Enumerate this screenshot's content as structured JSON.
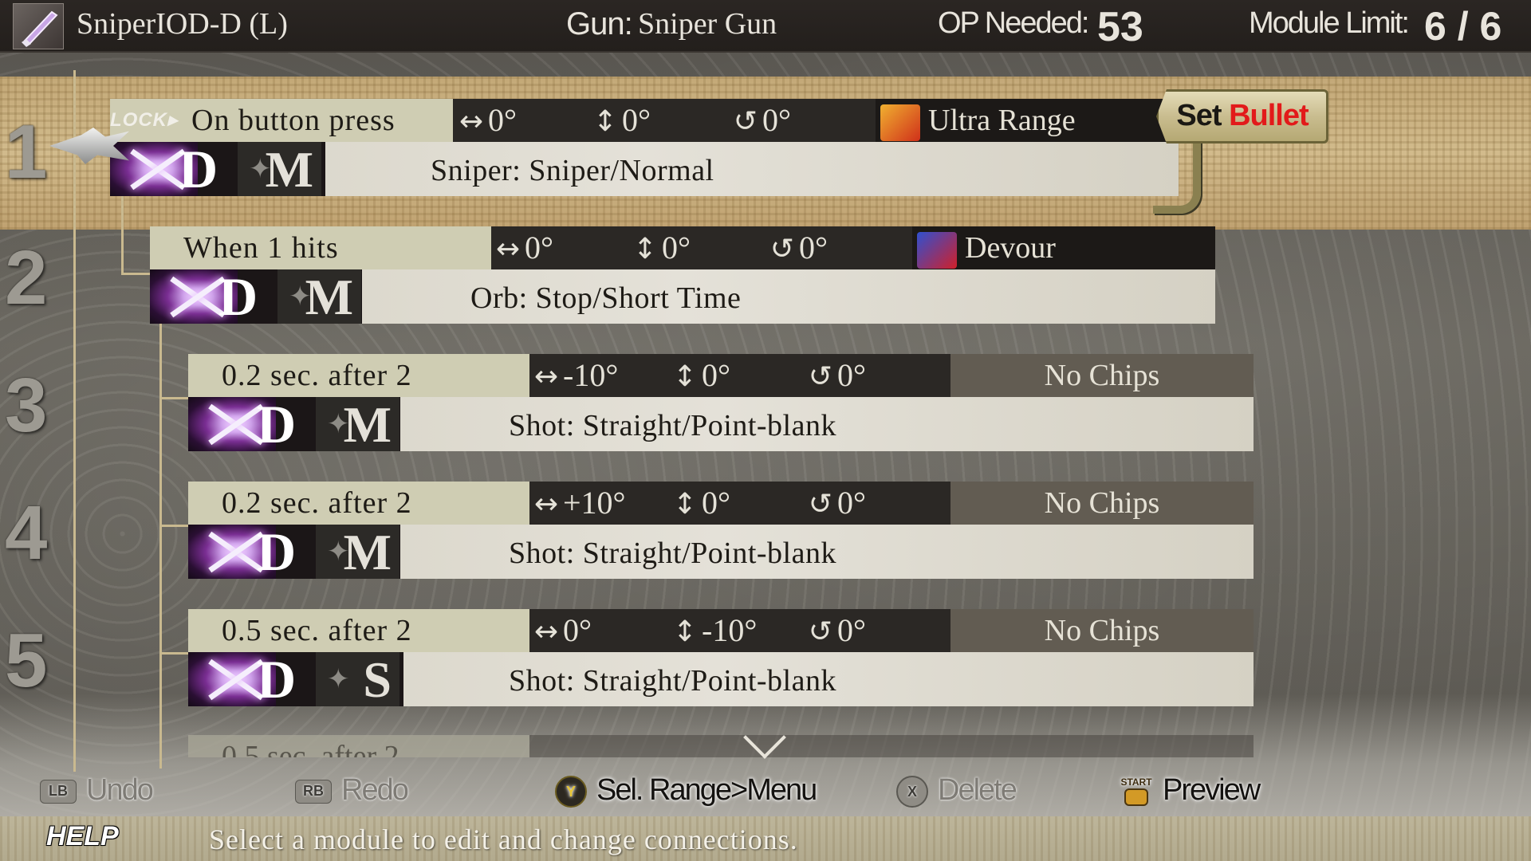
{
  "header": {
    "bullet_name": "SniperIOD-D (L)",
    "gun_label": "Gun:",
    "gun_value": "Sniper Gun",
    "op_label": "OP Needed:",
    "op_value": "53",
    "module_label": "Module  Limit:",
    "module_value": "6 / 6"
  },
  "lock_label": "LOCK▸",
  "set_bullet": {
    "part1": "Set ",
    "part2": "Bullet"
  },
  "rows": [
    {
      "number": "1",
      "trigger": "On button press",
      "h_angle": "0°",
      "v_angle": "0°",
      "r_angle": "0°",
      "chip": "Ultra Range",
      "badge_letter": "D",
      "size": "M",
      "bullet": "Sniper: Sniper/Normal"
    },
    {
      "number": "2",
      "trigger": "When  1  hits",
      "h_angle": "0°",
      "v_angle": "0°",
      "r_angle": "0°",
      "chip": "Devour",
      "badge_letter": "D",
      "size": "M",
      "bullet": "Orb: Stop/Short Time"
    },
    {
      "number": "3",
      "trigger": "0.2  sec.  after  2",
      "h_angle": "-10°",
      "v_angle": "0°",
      "r_angle": "0°",
      "chip": "No Chips",
      "badge_letter": "D",
      "size": "M",
      "bullet": "Shot: Straight/Point-blank"
    },
    {
      "number": "4",
      "trigger": "0.2  sec.  after  2",
      "h_angle": "+10°",
      "v_angle": "0°",
      "r_angle": "0°",
      "chip": "No Chips",
      "badge_letter": "D",
      "size": "M",
      "bullet": "Shot: Straight/Point-blank"
    },
    {
      "number": "5",
      "trigger": "0.5  sec.  after  2",
      "h_angle": "0°",
      "v_angle": "-10°",
      "r_angle": "0°",
      "chip": "No Chips",
      "badge_letter": "D",
      "size": "S",
      "bullet": "Shot: Straight/Point-blank"
    }
  ],
  "ghost_row": {
    "trigger": "0.5  sec.  after  2"
  },
  "controls": {
    "undo": {
      "button": "LB",
      "label": "Undo",
      "enabled": false
    },
    "redo": {
      "button": "RB",
      "label": "Redo",
      "enabled": false
    },
    "sel_range": {
      "button": "Y",
      "label": "Sel. Range>Menu",
      "enabled": true
    },
    "delete": {
      "button": "X",
      "label": "Delete",
      "enabled": false
    },
    "preview": {
      "button": "START",
      "label": "Preview",
      "enabled": true
    }
  },
  "help": {
    "label": "HELP",
    "text": "Select  a  module  to  edit  and  change  connections."
  },
  "colors": {
    "accent_red": "#e21a1a",
    "row_trigger_bg": "#cfcdb3",
    "highlight_band": "#d8c08f"
  }
}
